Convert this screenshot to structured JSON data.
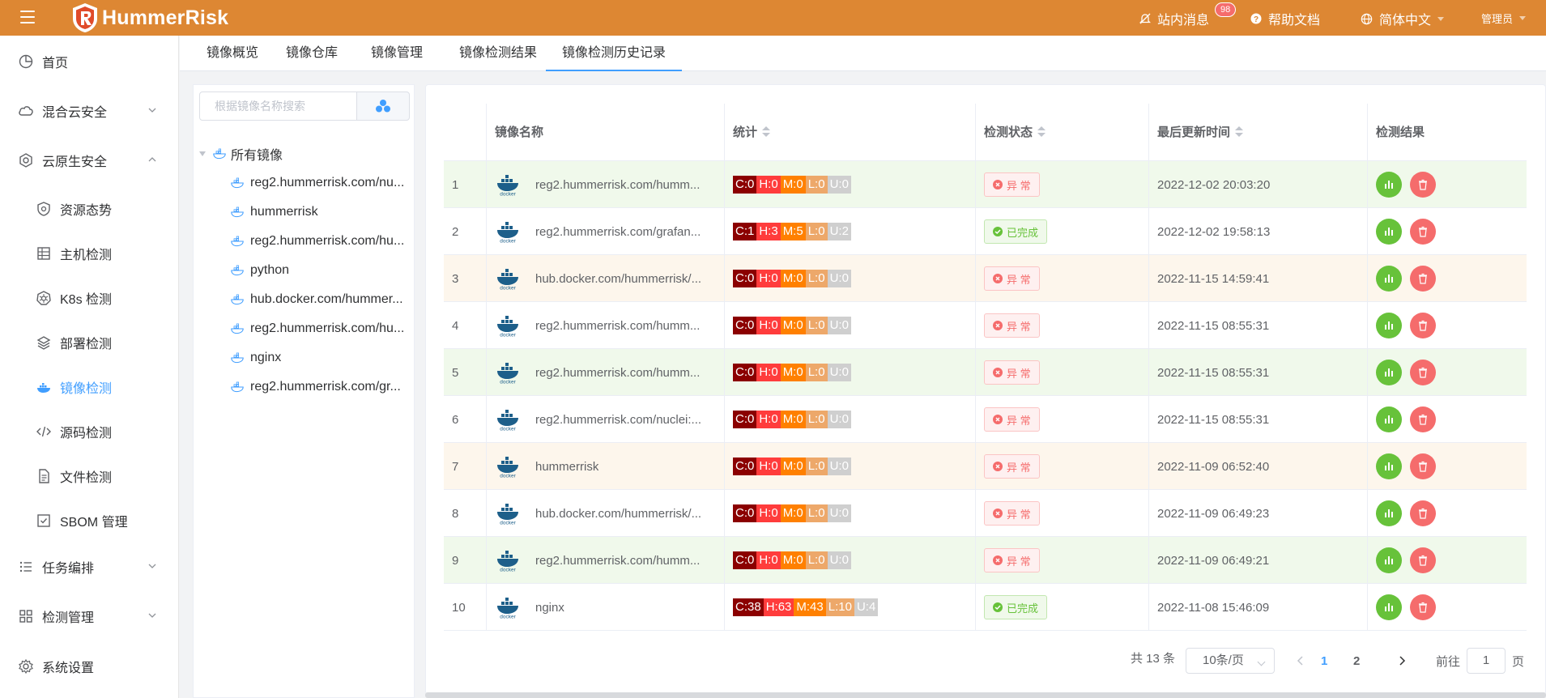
{
  "header": {
    "app_name": "HummerRisk",
    "messages_label": "站内消息",
    "messages_count": "98",
    "help_label": "帮助文档",
    "language_label": "简体中文",
    "user_label": "管理员"
  },
  "sidebar": {
    "items": [
      {
        "label": "首页",
        "icon": "pie-chart-icon"
      },
      {
        "label": "混合云安全",
        "icon": "cloud-icon"
      },
      {
        "label": "云原生安全",
        "icon": "cloud-native-icon"
      },
      {
        "label": "资源态势",
        "icon": "shield-icon"
      },
      {
        "label": "主机检测",
        "icon": "server-icon"
      },
      {
        "label": "K8s 检测",
        "icon": "k8s-icon"
      },
      {
        "label": "部署检测",
        "icon": "layers-icon"
      },
      {
        "label": "镜像检测",
        "icon": "docker-icon"
      },
      {
        "label": "源码检测",
        "icon": "code-icon"
      },
      {
        "label": "文件检测",
        "icon": "file-icon"
      },
      {
        "label": "SBOM 管理",
        "icon": "checkbox-icon"
      },
      {
        "label": "任务编排",
        "icon": "list-icon"
      },
      {
        "label": "检测管理",
        "icon": "grid-icon"
      },
      {
        "label": "系统设置",
        "icon": "gear-icon"
      }
    ]
  },
  "tabs": [
    {
      "label": "镜像概览"
    },
    {
      "label": "镜像仓库"
    },
    {
      "label": "镜像管理"
    },
    {
      "label": "镜像检测结果"
    },
    {
      "label": "镜像检测历史记录"
    }
  ],
  "tree": {
    "search_placeholder": "根据镜像名称搜索",
    "root_label": "所有镜像",
    "nodes": [
      "reg2.hummerrisk.com/nu...",
      "hummerrisk",
      "reg2.hummerrisk.com/hu...",
      "python",
      "hub.docker.com/hummer...",
      "reg2.hummerrisk.com/hu...",
      "nginx",
      "reg2.hummerrisk.com/gr..."
    ]
  },
  "table": {
    "columns": [
      "镜像名称",
      "统计",
      "检测状态",
      "最后更新时间",
      "检测结果"
    ],
    "rows": [
      {
        "no": "1",
        "name": "reg2.hummerrisk.com/humm...",
        "c": "C:0",
        "h": "H:0",
        "m": "M:0",
        "l": "L:0",
        "u": "U:0",
        "status": "异 常",
        "status_type": "err",
        "time": "2022-12-02 20:03:20",
        "tone": "green"
      },
      {
        "no": "2",
        "name": "reg2.hummerrisk.com/grafan...",
        "c": "C:1",
        "h": "H:3",
        "m": "M:5",
        "l": "L:0",
        "u": "U:2",
        "status": "已完成",
        "status_type": "ok",
        "time": "2022-12-02 19:58:13",
        "tone": "white"
      },
      {
        "no": "3",
        "name": "hub.docker.com/hummerrisk/...",
        "c": "C:0",
        "h": "H:0",
        "m": "M:0",
        "l": "L:0",
        "u": "U:0",
        "status": "异 常",
        "status_type": "err",
        "time": "2022-11-15 14:59:41",
        "tone": "orange"
      },
      {
        "no": "4",
        "name": "reg2.hummerrisk.com/humm...",
        "c": "C:0",
        "h": "H:0",
        "m": "M:0",
        "l": "L:0",
        "u": "U:0",
        "status": "异 常",
        "status_type": "err",
        "time": "2022-11-15 08:55:31",
        "tone": "white"
      },
      {
        "no": "5",
        "name": "reg2.hummerrisk.com/humm...",
        "c": "C:0",
        "h": "H:0",
        "m": "M:0",
        "l": "L:0",
        "u": "U:0",
        "status": "异 常",
        "status_type": "err",
        "time": "2022-11-15 08:55:31",
        "tone": "green"
      },
      {
        "no": "6",
        "name": "reg2.hummerrisk.com/nuclei:...",
        "c": "C:0",
        "h": "H:0",
        "m": "M:0",
        "l": "L:0",
        "u": "U:0",
        "status": "异 常",
        "status_type": "err",
        "time": "2022-11-15 08:55:31",
        "tone": "white"
      },
      {
        "no": "7",
        "name": "hummerrisk",
        "c": "C:0",
        "h": "H:0",
        "m": "M:0",
        "l": "L:0",
        "u": "U:0",
        "status": "异 常",
        "status_type": "err",
        "time": "2022-11-09 06:52:40",
        "tone": "orange"
      },
      {
        "no": "8",
        "name": "hub.docker.com/hummerrisk/...",
        "c": "C:0",
        "h": "H:0",
        "m": "M:0",
        "l": "L:0",
        "u": "U:0",
        "status": "异 常",
        "status_type": "err",
        "time": "2022-11-09 06:49:23",
        "tone": "white"
      },
      {
        "no": "9",
        "name": "reg2.hummerrisk.com/humm...",
        "c": "C:0",
        "h": "H:0",
        "m": "M:0",
        "l": "L:0",
        "u": "U:0",
        "status": "异 常",
        "status_type": "err",
        "time": "2022-11-09 06:49:21",
        "tone": "green"
      },
      {
        "no": "10",
        "name": "nginx",
        "c": "C:38",
        "h": "H:63",
        "m": "M:43",
        "l": "L:10",
        "u": "U:4",
        "status": "已完成",
        "status_type": "ok",
        "time": "2022-11-08 15:46:09",
        "tone": "white"
      }
    ]
  },
  "pagination": {
    "total": "共 13 条",
    "page_size": "10条/页",
    "pages": [
      "1",
      "2"
    ],
    "goto_label": "前往",
    "goto_value": "1",
    "page_suffix": "页"
  },
  "colors": {
    "header_bg": "#dd8733",
    "accent": "#409eff",
    "critical": "#8b0000",
    "high": "#ff3c3c",
    "medium": "#ff8000",
    "low": "#eda86a",
    "unknown": "#cfcfcf"
  }
}
